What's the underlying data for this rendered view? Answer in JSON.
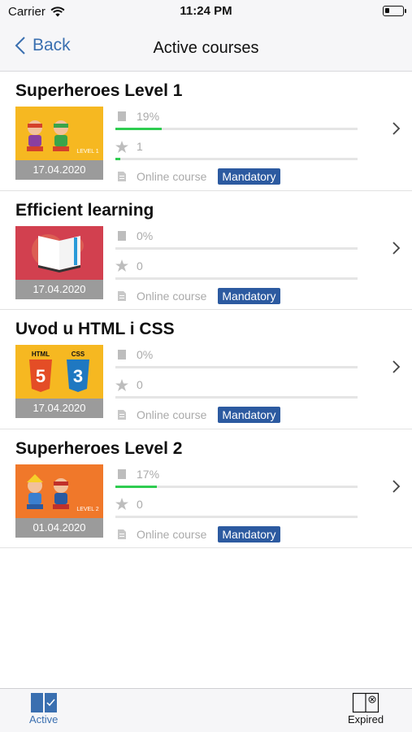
{
  "status": {
    "carrier": "Carrier",
    "time": "11:24 PM"
  },
  "nav": {
    "back_label": "Back",
    "title": "Active courses"
  },
  "courses": [
    {
      "title": "Superheroes Level 1",
      "date": "17.04.2020",
      "progress": "19%",
      "progress_value": 19,
      "rating": "1",
      "rating_value": 1,
      "type": "Online course",
      "badge": "Mandatory",
      "art": "superheroes-1",
      "art_label": "LEVEL 1"
    },
    {
      "title": "Efficient learning",
      "date": "17.04.2020",
      "progress": "0%",
      "progress_value": 0,
      "rating": "0",
      "rating_value": 0,
      "type": "Online course",
      "badge": "Mandatory",
      "art": "book"
    },
    {
      "title": "Uvod u HTML i CSS",
      "date": "17.04.2020",
      "progress": "0%",
      "progress_value": 0,
      "rating": "0",
      "rating_value": 0,
      "type": "Online course",
      "badge": "Mandatory",
      "art": "html-css",
      "art_label_1": "HTML",
      "art_label_2": "CSS"
    },
    {
      "title": "Superheroes Level 2",
      "date": "01.04.2020",
      "progress": "17%",
      "progress_value": 17,
      "rating": "0",
      "rating_value": 0,
      "type": "Online course",
      "badge": "Mandatory",
      "art": "superheroes-2",
      "art_label": "LEVEL 2"
    }
  ],
  "tabs": {
    "active_label": "Active",
    "expired_label": "Expired"
  },
  "colors": {
    "accent": "#3a6fb0",
    "badge": "#2c5aa0",
    "progress": "#2ecc50"
  }
}
